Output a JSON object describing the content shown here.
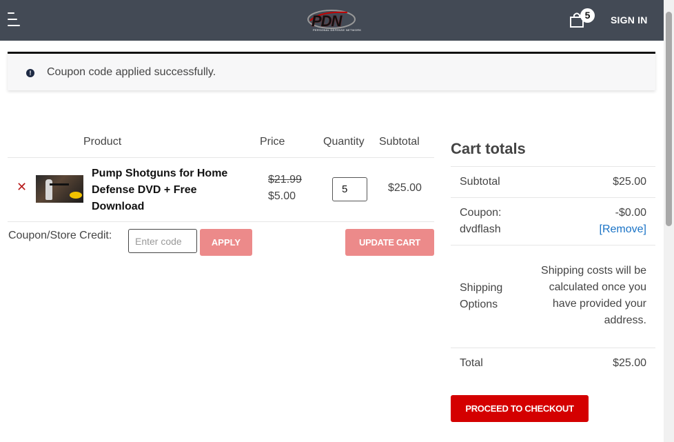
{
  "header": {
    "logo_text": "PDN",
    "logo_sub": "PERSONAL DEFENSE NETWORK",
    "cart_count": "5",
    "sign_in": "SIGN IN"
  },
  "notice": {
    "icon": "info-circle-icon",
    "message": "Coupon code applied successfully."
  },
  "cart_table": {
    "headers": {
      "product": "Product",
      "price": "Price",
      "quantity": "Quantity",
      "subtotal": "Subtotal"
    },
    "items": [
      {
        "name": "Pump Shotguns for Home Defense DVD + Free Download",
        "price_old": "$21.99",
        "price_new": "$5.00",
        "quantity": "5",
        "subtotal": "$25.00",
        "remove_icon": "remove-x-icon"
      }
    ],
    "coupon_label": "Coupon/Store Credit:",
    "coupon_placeholder": "Enter code",
    "apply_label": "APPLY",
    "update_label": "UPDATE CART"
  },
  "totals": {
    "title": "Cart totals",
    "subtotal_label": "Subtotal",
    "subtotal_value": "$25.00",
    "coupon_label_1": "Coupon:",
    "coupon_label_2": "dvdflash",
    "coupon_value": "-$0.00",
    "coupon_remove": "[Remove]",
    "shipping_label_1": "Shipping",
    "shipping_label_2": "Options",
    "shipping_text": "Shipping costs will be calculated once you have provided your address.",
    "total_label": "Total",
    "total_value": "$25.00",
    "checkout_label": "PROCEED TO CHECKOUT"
  },
  "colors": {
    "header_bg": "#434a55",
    "button_disabled": "#ec8a8a",
    "checkout_red": "#d40000",
    "link_blue": "#1a73c6"
  }
}
